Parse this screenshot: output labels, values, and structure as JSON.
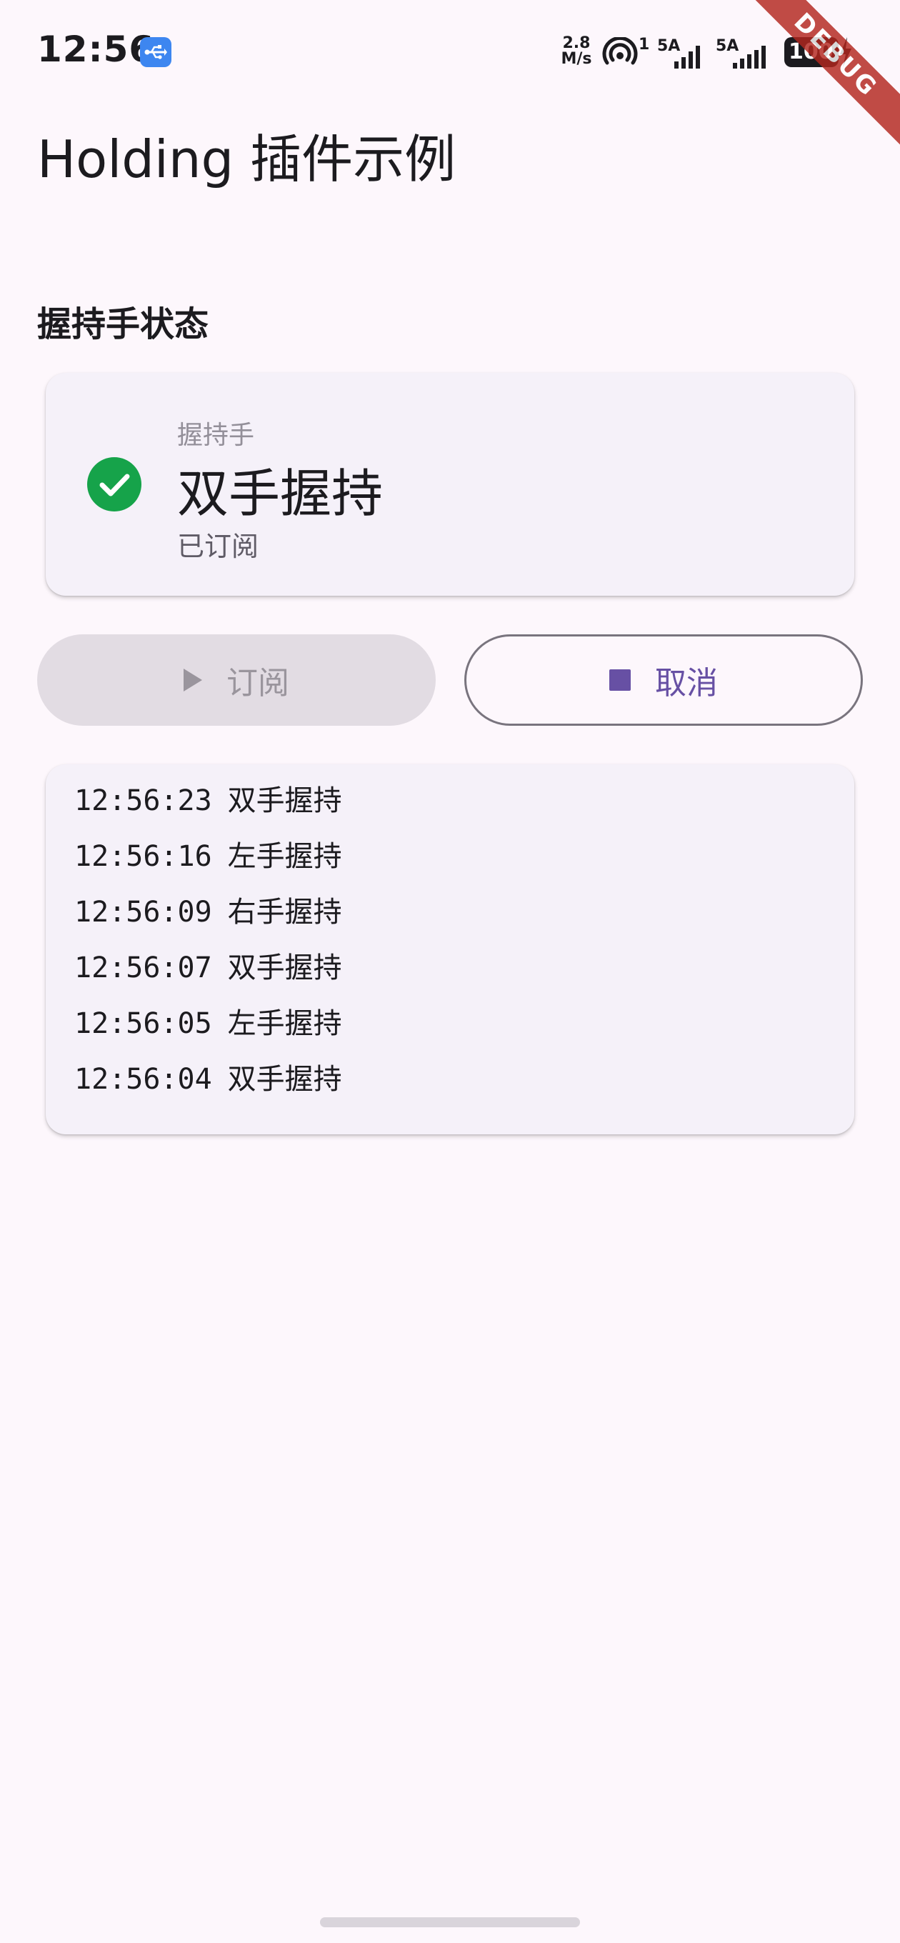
{
  "status_bar": {
    "time": "12:56",
    "net_speed_value": "2.8",
    "net_speed_unit": "M/s",
    "hotspot_count": "1",
    "signal1_label": "5A",
    "signal2_label": "5A",
    "battery": "100",
    "usb_icon": "usb-icon",
    "colors": {
      "usb_badge": "#3d86f0"
    }
  },
  "debug_banner": "DEBUG",
  "app_bar": {
    "title": "Holding 插件示例"
  },
  "section": {
    "title": "握持手状态"
  },
  "status_card": {
    "caption": "握持手",
    "value": "双手握持",
    "subtitle": "已订阅",
    "icon": "check-circle-icon",
    "colors": {
      "check": "#16a34a"
    }
  },
  "actions": {
    "subscribe_label": "订阅",
    "cancel_label": "取消",
    "subscribe_enabled": false,
    "colors": {
      "primary": "#6750a4"
    }
  },
  "log": {
    "entries": [
      {
        "time": "12:56:23",
        "text": "双手握持"
      },
      {
        "time": "12:56:16",
        "text": "左手握持"
      },
      {
        "time": "12:56:09",
        "text": "右手握持"
      },
      {
        "time": "12:56:07",
        "text": "双手握持"
      },
      {
        "time": "12:56:05",
        "text": "左手握持"
      },
      {
        "time": "12:56:04",
        "text": "双手握持"
      }
    ]
  }
}
